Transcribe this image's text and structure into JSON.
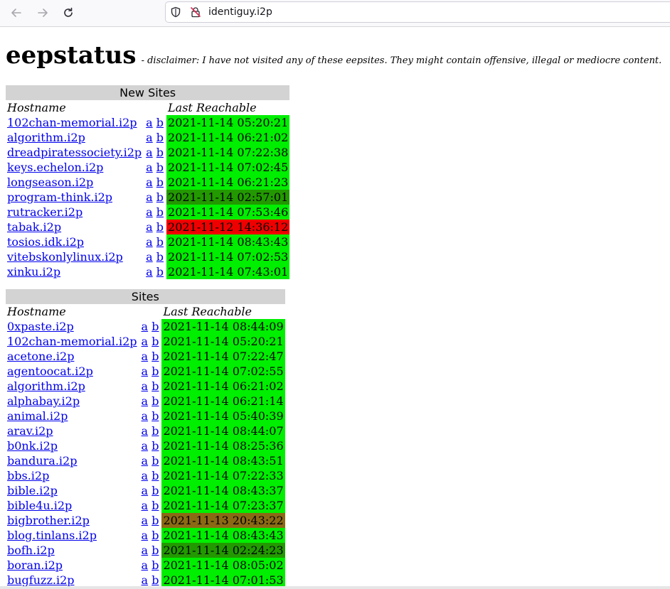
{
  "browser": {
    "url": "identiguy.i2p",
    "back_icon": "arrow-left",
    "forward_icon": "arrow-right",
    "reload_icon": "reload",
    "shield_icon": "tracking-protection-shield",
    "insecure_icon": "insecure-lock"
  },
  "page": {
    "title": "eepstatus",
    "disclaimer": "- disclaimer: I have not visited any of these eepsites. They might contain offensive, illegal or mediocre content."
  },
  "new_sites": {
    "caption": "New Sites",
    "col_hostname": "Hostname",
    "col_last": "Last Reachable",
    "rows": [
      {
        "host": "102chan-memorial.i2p",
        "a": "a",
        "b": "b",
        "time": "2021-11-14 05:20:21",
        "status": "g"
      },
      {
        "host": "algorithm.i2p",
        "a": "a",
        "b": "b",
        "time": "2021-11-14 06:21:02",
        "status": "g"
      },
      {
        "host": "dreadpiratessociety.i2p",
        "a": "a",
        "b": "b",
        "time": "2021-11-14 07:22:38",
        "status": "g"
      },
      {
        "host": "keys.echelon.i2p",
        "a": "a",
        "b": "b",
        "time": "2021-11-14 07:02:45",
        "status": "g"
      },
      {
        "host": "longseason.i2p",
        "a": "a",
        "b": "b",
        "time": "2021-11-14 06:21:23",
        "status": "g"
      },
      {
        "host": "program-think.i2p",
        "a": "a",
        "b": "b",
        "time": "2021-11-14 02:57:01",
        "status": "dg"
      },
      {
        "host": "rutracker.i2p",
        "a": "a",
        "b": "b",
        "time": "2021-11-14 07:53:46",
        "status": "g"
      },
      {
        "host": "tabak.i2p",
        "a": "a",
        "b": "b",
        "time": "2021-11-12 14:36:12",
        "status": "r"
      },
      {
        "host": "tosios.idk.i2p",
        "a": "a",
        "b": "b",
        "time": "2021-11-14 08:43:43",
        "status": "g"
      },
      {
        "host": "vitebskonlylinux.i2p",
        "a": "a",
        "b": "b",
        "time": "2021-11-14 07:02:53",
        "status": "g"
      },
      {
        "host": "xinku.i2p",
        "a": "a",
        "b": "b",
        "time": "2021-11-14 07:43:01",
        "status": "g"
      }
    ]
  },
  "sites": {
    "caption": "Sites",
    "col_hostname": "Hostname",
    "col_last": "Last Reachable",
    "rows": [
      {
        "host": "0xpaste.i2p",
        "a": "a",
        "b": "b",
        "time": "2021-11-14 08:44:09",
        "status": "g"
      },
      {
        "host": "102chan-memorial.i2p",
        "a": "a",
        "b": "b",
        "time": "2021-11-14 05:20:21",
        "status": "g"
      },
      {
        "host": "acetone.i2p",
        "a": "a",
        "b": "b",
        "time": "2021-11-14 07:22:47",
        "status": "g"
      },
      {
        "host": "agentoocat.i2p",
        "a": "a",
        "b": "b",
        "time": "2021-11-14 07:02:55",
        "status": "g"
      },
      {
        "host": "algorithm.i2p",
        "a": "a",
        "b": "b",
        "time": "2021-11-14 06:21:02",
        "status": "g"
      },
      {
        "host": "alphabay.i2p",
        "a": "a",
        "b": "b",
        "time": "2021-11-14 06:21:14",
        "status": "g"
      },
      {
        "host": "animal.i2p",
        "a": "a",
        "b": "b",
        "time": "2021-11-14 05:40:39",
        "status": "g"
      },
      {
        "host": "arav.i2p",
        "a": "a",
        "b": "b",
        "time": "2021-11-14 08:44:07",
        "status": "g"
      },
      {
        "host": "b0nk.i2p",
        "a": "a",
        "b": "b",
        "time": "2021-11-14 08:25:36",
        "status": "g"
      },
      {
        "host": "bandura.i2p",
        "a": "a",
        "b": "b",
        "time": "2021-11-14 08:43:51",
        "status": "g"
      },
      {
        "host": "bbs.i2p",
        "a": "a",
        "b": "b",
        "time": "2021-11-14 07:22:33",
        "status": "g"
      },
      {
        "host": "bible.i2p",
        "a": "a",
        "b": "b",
        "time": "2021-11-14 08:43:37",
        "status": "g"
      },
      {
        "host": "bible4u.i2p",
        "a": "a",
        "b": "b",
        "time": "2021-11-14 07:23:37",
        "status": "g"
      },
      {
        "host": "bigbrother.i2p",
        "a": "a",
        "b": "b",
        "time": "2021-11-13 20:43:22",
        "status": "br"
      },
      {
        "host": "blog.tinlans.i2p",
        "a": "a",
        "b": "b",
        "time": "2021-11-14 08:43:43",
        "status": "g"
      },
      {
        "host": "bofh.i2p",
        "a": "a",
        "b": "b",
        "time": "2021-11-14 02:24:23",
        "status": "dg"
      },
      {
        "host": "boran.i2p",
        "a": "a",
        "b": "b",
        "time": "2021-11-14 08:05:02",
        "status": "g"
      },
      {
        "host": "bugfuzz.i2p",
        "a": "a",
        "b": "b",
        "time": "2021-11-14 07:01:53",
        "status": "g"
      }
    ]
  },
  "colors": {
    "g": "#00ee00",
    "dg": "#229900",
    "r": "#ee0000",
    "br": "#8b6914",
    "caption_bg": "#d3d3d3",
    "link": "#0000ee"
  }
}
